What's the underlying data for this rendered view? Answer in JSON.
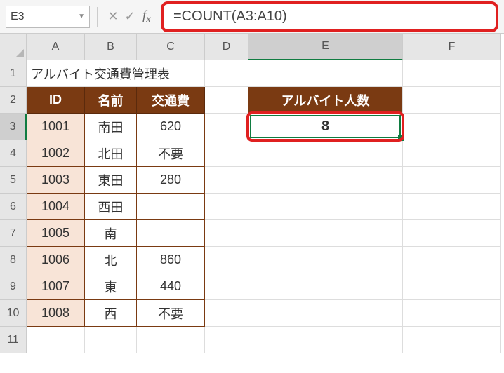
{
  "nameBox": "E3",
  "formula": "=COUNT(A3:A10)",
  "columns": [
    "A",
    "B",
    "C",
    "D",
    "E",
    "F"
  ],
  "rows": [
    "1",
    "2",
    "3",
    "4",
    "5",
    "6",
    "7",
    "8",
    "9",
    "10",
    "11"
  ],
  "title": "アルバイト交通費管理表",
  "headers": {
    "id": "ID",
    "name": "名前",
    "fare": "交通費",
    "eHeader": "アルバイト人数"
  },
  "data": [
    {
      "id": "1001",
      "name": "南田",
      "fare": "620"
    },
    {
      "id": "1002",
      "name": "北田",
      "fare": "不要"
    },
    {
      "id": "1003",
      "name": "東田",
      "fare": "280"
    },
    {
      "id": "1004",
      "name": "西田",
      "fare": ""
    },
    {
      "id": "1005",
      "name": "南",
      "fare": ""
    },
    {
      "id": "1006",
      "name": "北",
      "fare": "860"
    },
    {
      "id": "1007",
      "name": "東",
      "fare": "440"
    },
    {
      "id": "1008",
      "name": "西",
      "fare": "不要"
    }
  ],
  "result": "8"
}
